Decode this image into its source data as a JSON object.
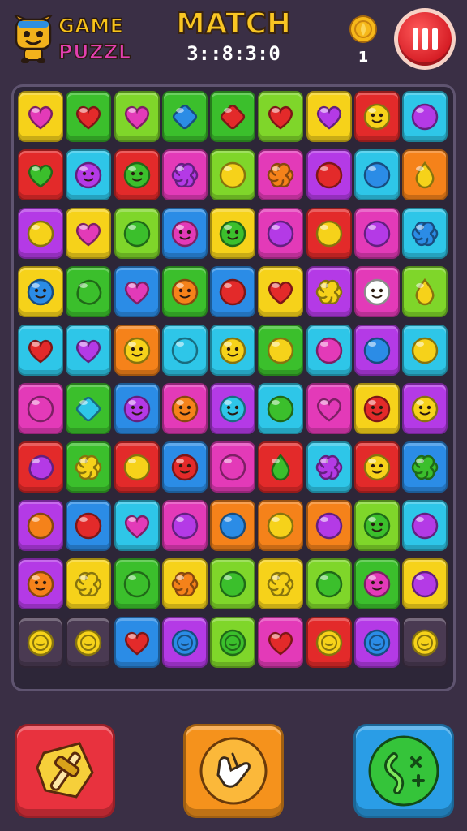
{
  "header": {
    "logo_line1": "GAME",
    "logo_line2": "PUZZL",
    "title": "MATCH",
    "timer": "3::8:3:0",
    "coins": "1"
  },
  "colors": {
    "R": "#e32a2a",
    "G": "#3bbf2c",
    "B": "#2b8ce6",
    "Y": "#f6d21a",
    "P": "#b43ae6",
    "M": "#e33ab8",
    "O": "#f5821a",
    "C": "#2ec6e8",
    "L": "#7fd62a"
  },
  "board": {
    "tiles": [
      [
        "Y-M-heart",
        "G-R-heart",
        "L-M-heart",
        "G-B-gem",
        "G-R-gem",
        "L-R-heart",
        "Y-P-heart",
        "R-Y-face",
        "C-P-circle"
      ],
      [
        "R-G-heart",
        "C-P-face",
        "R-G-face",
        "M-P-flower",
        "L-Y-circle",
        "M-O-flower",
        "P-R-circle",
        "C-B-circle",
        "O-Y-drop"
      ],
      [
        "P-Y-circle",
        "Y-M-heart",
        "L-G-circle",
        "B-M-face",
        "Y-G-face",
        "M-P-circle",
        "R-Y-circle",
        "M-P-circle",
        "C-B-flower"
      ],
      [
        "Y-B-face",
        "G-G-blob",
        "B-M-heart",
        "G-O-face",
        "B-R-circle",
        "Y-R-heart",
        "P-Y-flower",
        "M-W-face",
        "L-Y-drop"
      ],
      [
        "C-R-heart",
        "C-P-heart",
        "O-Y-face",
        "C-C-circle",
        "C-Y-face",
        "G-Y-circle",
        "C-M-circle",
        "P-B-circle",
        "C-Y-circle"
      ],
      [
        "M-M-circle",
        "G-C-gem",
        "B-P-face",
        "M-O-face",
        "P-C-face",
        "C-G-circle",
        "M-M-heart",
        "Y-R-face",
        "P-Y-face"
      ],
      [
        "R-P-blob",
        "G-Y-flower",
        "R-Y-circle",
        "B-R-face",
        "M-M-circle",
        "R-G-drop",
        "C-P-flower",
        "R-Y-face",
        "B-G-flower"
      ],
      [
        "P-O-circle",
        "B-R-circle",
        "C-M-heart",
        "M-P-circle",
        "O-B-circle",
        "O-Y-circle",
        "O-P-circle",
        "L-G-face",
        "C-P-circle"
      ],
      [
        "P-O-face",
        "Y-Y-flower",
        "G-G-circle",
        "Y-O-flower",
        "L-G-circle",
        "Y-Y-flower",
        "L-G-circle",
        "G-M-face",
        "Y-P-circle"
      ],
      [
        "D-Y-coin",
        "D-Y-coin",
        "B-R-heart",
        "P-B-coin",
        "L-G-coin",
        "M-R-heart",
        "R-Y-coin",
        "P-B-coin",
        "D-Y-coin"
      ]
    ]
  },
  "boosters": [
    {
      "name": "hammer",
      "icon": "hammer-icon",
      "color": "#e8323e"
    },
    {
      "name": "glove",
      "icon": "glove-icon",
      "color": "#f5921c"
    },
    {
      "name": "shuffle",
      "icon": "shuffle-icon",
      "color": "#2a9de6"
    }
  ]
}
